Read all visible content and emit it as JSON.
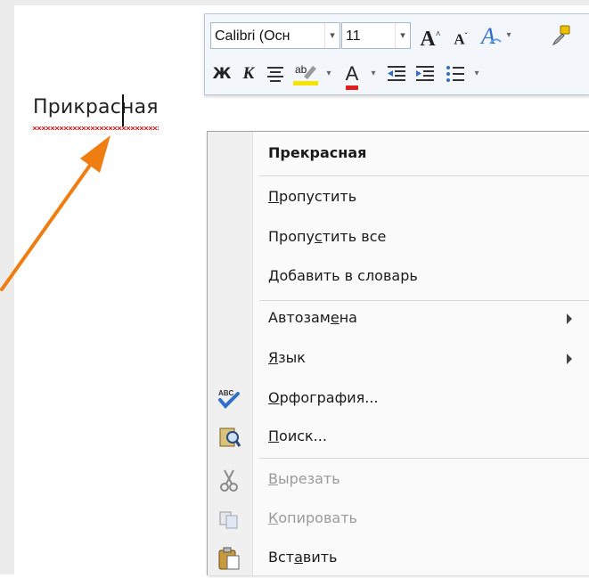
{
  "document": {
    "word": "Прикрасная"
  },
  "mini_toolbar": {
    "font_name": "Calibri (Осн",
    "font_size": "11",
    "buttons_row1": [
      "grow-font",
      "shrink-font",
      "styles",
      "format-painter"
    ],
    "bold_label": "Ж",
    "italic_label": "К",
    "grow_font_label": "A",
    "shrink_font_label": "A",
    "font_color_label": "A",
    "highlight_label": "ab",
    "highlight_color": "#f5e400",
    "font_color": "#e21d1d"
  },
  "context_menu": {
    "suggestion": "Прекрасная",
    "items": [
      {
        "pre": "",
        "key": "П",
        "post": "ропустить"
      },
      {
        "pre": "Пропу",
        "key": "с",
        "post": "тить все"
      },
      {
        "pre": "",
        "key": "Д",
        "post": "обавить в словарь"
      },
      {
        "pre": "Автозам",
        "key": "е",
        "post": "на"
      },
      {
        "pre": "",
        "key": "Я",
        "post": "зык"
      },
      {
        "pre": "",
        "key": "О",
        "post": "рфография..."
      },
      {
        "pre": "",
        "key": "П",
        "post": "оиск..."
      },
      {
        "pre": "",
        "key": "В",
        "post": "ырезать"
      },
      {
        "pre": "",
        "key": "К",
        "post": "опировать"
      },
      {
        "pre": "Вст",
        "key": "а",
        "post": "вить"
      }
    ],
    "spell_icon_label": "ABC"
  },
  "colors": {
    "arrow": "#ef7d12",
    "squiggle": "#d22222",
    "menu_border": "#a6a6a6"
  }
}
